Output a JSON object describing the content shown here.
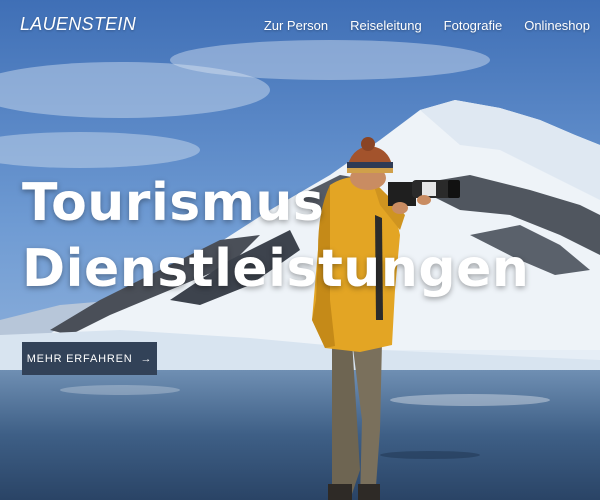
{
  "brand": {
    "logo_text": "LAUENSTEIN"
  },
  "nav": {
    "items": [
      {
        "label": "Zur Person"
      },
      {
        "label": "Reiseleitung"
      },
      {
        "label": "Fotografie"
      },
      {
        "label": "Onlineshop"
      }
    ]
  },
  "hero": {
    "headline_line1": "Tourismus",
    "headline_line2": "Dienstleistungen",
    "cta_label": "MEHR ERFAHREN",
    "cta_icon": "arrow-right-icon",
    "background": "Photographer in yellow jacket with camera in front of snowy mountains and icy water"
  },
  "colors": {
    "cta_bg": "#324258",
    "text": "#ffffff"
  }
}
